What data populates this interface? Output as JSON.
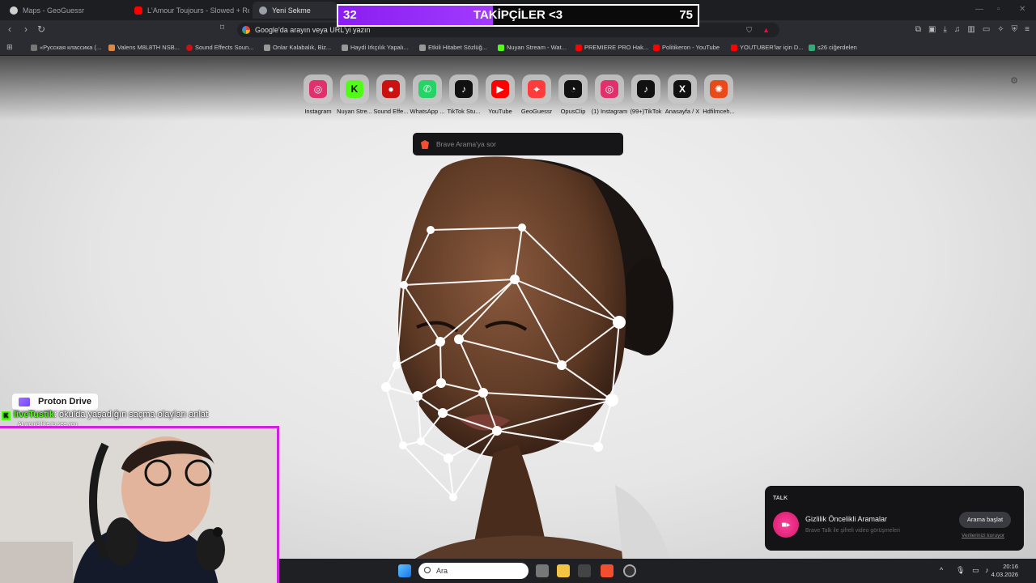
{
  "tabs": [
    {
      "label": "Maps - GeoGuessr",
      "active": false
    },
    {
      "label": "L'Amour Toujours - Slowed + Re",
      "active": false
    },
    {
      "label": "Yeni Sekme",
      "active": true
    }
  ],
  "follower_goal": {
    "current": "32",
    "title": "TAKİPÇİLER <3",
    "goal": "75",
    "progress": 0.43
  },
  "address_bar": {
    "placeholder": "Google'da arayın veya URL'yi yazın"
  },
  "bookmarks": [
    "«Русская классика (...",
    "Valens M8L8TH NSB...",
    "Sound Effects Soun...",
    "Onlar Kalabalık, Biz...",
    "Haydi Irkçılık Yapalı...",
    "Etkili Hitabet Sözlüğ...",
    "Nuyan Stream - Wat...",
    "PREMIERE PRO Hak...",
    "Politikeron - YouTube",
    "YOUTUBER'lar için D...",
    "s26 ciğerdelen"
  ],
  "speed_dials": [
    {
      "label": "Instagram",
      "icon": "instagram-icon",
      "color": "#e1306c"
    },
    {
      "label": "Nuyan Stre...",
      "icon": "kick-icon",
      "color": "#53fc18"
    },
    {
      "label": "Sound Effe...",
      "icon": "sound-effects-icon",
      "color": "#cc1111"
    },
    {
      "label": "WhatsApp ...",
      "icon": "whatsapp-icon",
      "color": "#25d366"
    },
    {
      "label": "TikTok Stu...",
      "icon": "tiktok-icon",
      "color": "#111111"
    },
    {
      "label": "YouTube",
      "icon": "youtube-icon",
      "color": "#ff0000"
    },
    {
      "label": "GeoGuessr",
      "icon": "geoguessr-icon",
      "color": "#ff3b3b"
    },
    {
      "label": "OpusClip",
      "icon": "opusclip-icon",
      "color": "#111111"
    },
    {
      "label": "(1) Instagram",
      "icon": "instagram-icon",
      "color": "#e1306c"
    },
    {
      "label": "(99+)TikTok",
      "icon": "tiktok-icon",
      "color": "#111111"
    },
    {
      "label": "Anasayfa / X",
      "icon": "x-icon",
      "color": "#111111"
    },
    {
      "label": "Hdfilmceh...",
      "icon": "hdfilm-icon",
      "color": "#e84a1a"
    }
  ],
  "search": {
    "placeholder": "Brave Arama'ya sor"
  },
  "talk_card": {
    "header": "TALK",
    "title": "Gizlilik Öncelikli Aramalar",
    "subtitle": "Brave Talk ile şifreli video görüşmeleri",
    "button": "Arama başlat",
    "link": "Verilerinizi koruyor"
  },
  "overlay": {
    "proton": "Proton Drive",
    "chat_user": "liveTustik",
    "chat_message": ": okulda yaşadığın saçma olayları anlat",
    "chat_sub": "AI would like to see you"
  },
  "taskbar": {
    "search_placeholder": "Ara",
    "time": "20:16",
    "date": "4.03.2026"
  }
}
